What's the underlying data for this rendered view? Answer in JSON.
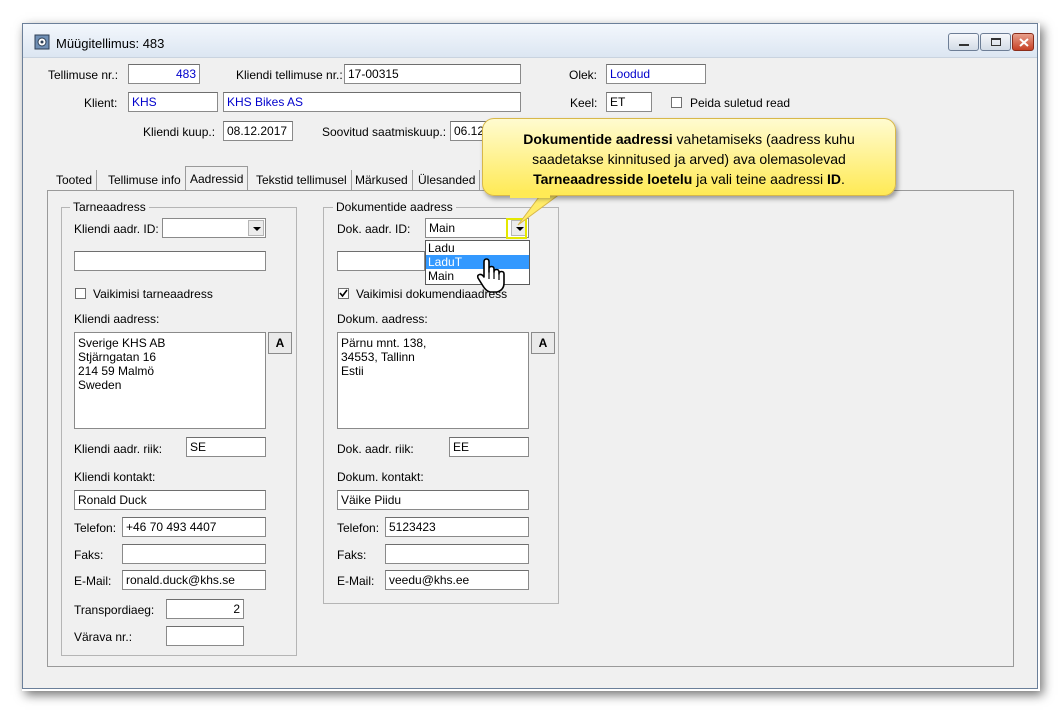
{
  "window": {
    "title": "Müügitellimus: 483"
  },
  "header": {
    "order_no_label": "Tellimuse nr.:",
    "order_no": "483",
    "client_order_label": "Kliendi tellimuse nr.:",
    "client_order": "17-00315",
    "status_label": "Olek:",
    "status": "Loodud",
    "client_label": "Klient:",
    "client_code": "KHS",
    "client_name": "KHS Bikes AS",
    "language_label": "Keel:",
    "language": "ET",
    "hide_closed_label": "Peida suletud read",
    "client_date_label": "Kliendi kuup.:",
    "client_date": "08.12.2017",
    "desired_ship_label": "Soovitud saatmiskuup.:",
    "desired_ship": "06.12"
  },
  "tabs": [
    {
      "label": "Tooted"
    },
    {
      "label": "Tellimuse info"
    },
    {
      "label": "Aadressid"
    },
    {
      "label": "Tekstid tellimusel"
    },
    {
      "label": "Märkused"
    },
    {
      "label": "Ülesanded"
    }
  ],
  "delivery": {
    "group_title": "Tarneaadress",
    "addr_id_label": "Kliendi aadr. ID:",
    "addr_id": "",
    "addr_name": "",
    "default_label": "Vaikimisi tarneaadress",
    "address_label": "Kliendi aadress:",
    "address": "Sverige KHS AB\nStjärngatan 16\n214 59 Malmö\nSweden",
    "a_button": "A",
    "country_label": "Kliendi aadr. riik:",
    "country": "SE",
    "contact_label": "Kliendi kontakt:",
    "contact": "Ronald Duck",
    "phone_label": "Telefon:",
    "phone": "+46 70 493 4407",
    "fax_label": "Faks:",
    "fax": "",
    "email_label": "E-Mail:",
    "email": "ronald.duck@khs.se",
    "transport_label": "Transpordiaeg:",
    "transport": "2",
    "gate_label": "Värava nr.:",
    "gate": ""
  },
  "documents": {
    "group_title": "Dokumentide aadress",
    "addr_id_label": "Dok. aadr. ID:",
    "addr_id": "Main",
    "dropdown_options": [
      "Ladu",
      "LaduT",
      "Main"
    ],
    "default_label": "Vaikimisi dokumendiaadress",
    "address_label": "Dokum. aadress:",
    "address": "Pärnu mnt. 138,\n34553, Tallinn\nEstii",
    "a_button": "A",
    "country_label": "Dok. aadr. riik:",
    "country": "EE",
    "contact_label": "Dokum. kontakt:",
    "contact": "Väike Piidu",
    "phone_label": "Telefon:",
    "phone": "5123423",
    "fax_label": "Faks:",
    "fax": "",
    "email_label": "E-Mail:",
    "email": "veedu@khs.ee"
  },
  "callout": {
    "bold1": "Dokumentide aadressi",
    "text1": " vahetamiseks (aadress kuhu saadetakse kinnitused ja arved) ava olemasolevad ",
    "bold2": "Tarneaadresside loetelu",
    "text2": " ja vali teine aadressi ",
    "bold3": "ID",
    "text3": "."
  },
  "colors": {
    "accent_blue": "#0000cc",
    "selection": "#3399ff",
    "callout_yellow": "#ffea55"
  }
}
